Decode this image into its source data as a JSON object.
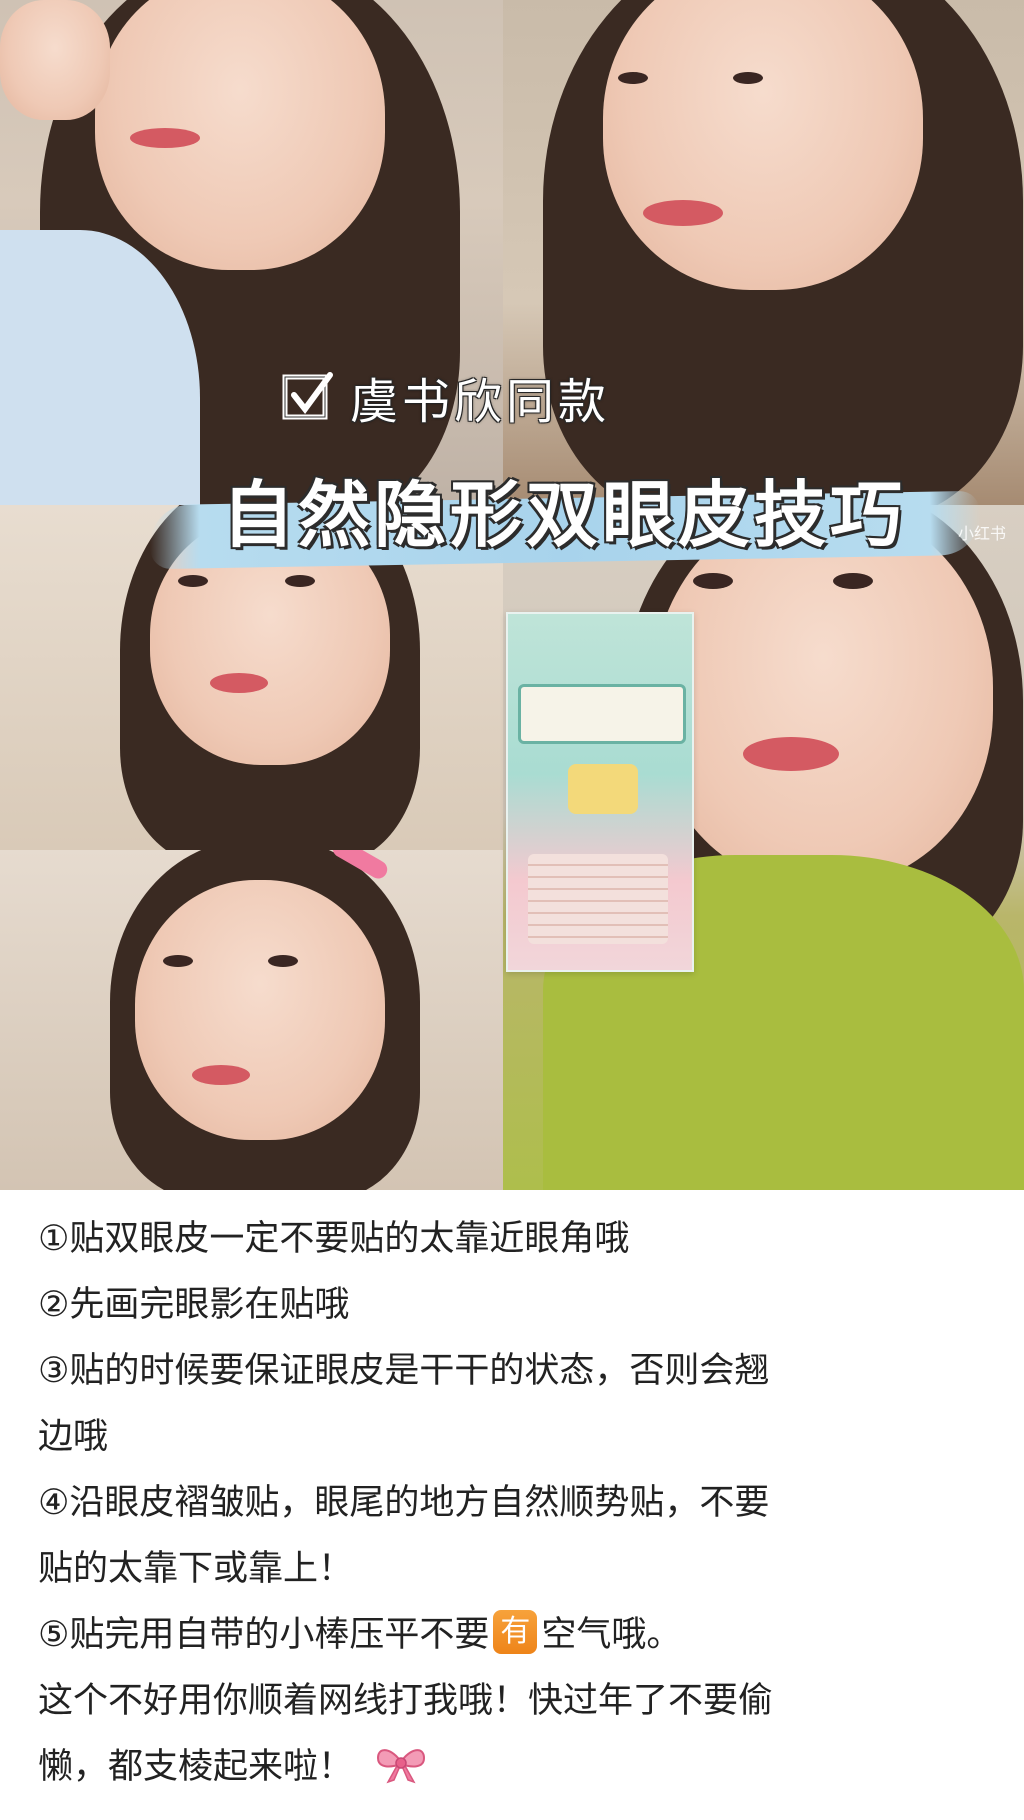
{
  "overlay": {
    "subtitle": "虞书欣同款",
    "title": "自然隐形双眼皮技巧",
    "watermark": "小红书"
  },
  "tips": [
    "①贴双眼皮一定不要贴的太靠近眼角哦",
    "②先画完眼影在贴哦",
    "③贴的时候要保证眼皮是干干的状态，否则会翘",
    "边哦",
    "④沿眼皮褶皱贴，眼尾的地方自然顺势贴，不要",
    "贴的太靠下或靠上！"
  ],
  "tip5": {
    "before": "⑤贴完用自带的小棒压平不要",
    "badge": "有",
    "after": "空气哦。"
  },
  "closing": [
    "这个不好用你顺着网线打我哦！快过年了不要偷",
    "懒，都支棱起来啦！"
  ],
  "icons": {
    "check": "check-box-icon",
    "bow": "pink-bow-icon"
  },
  "colors": {
    "brush": "#a8d3ec",
    "badge": "#ee8419",
    "bow": "#f08aa8"
  }
}
